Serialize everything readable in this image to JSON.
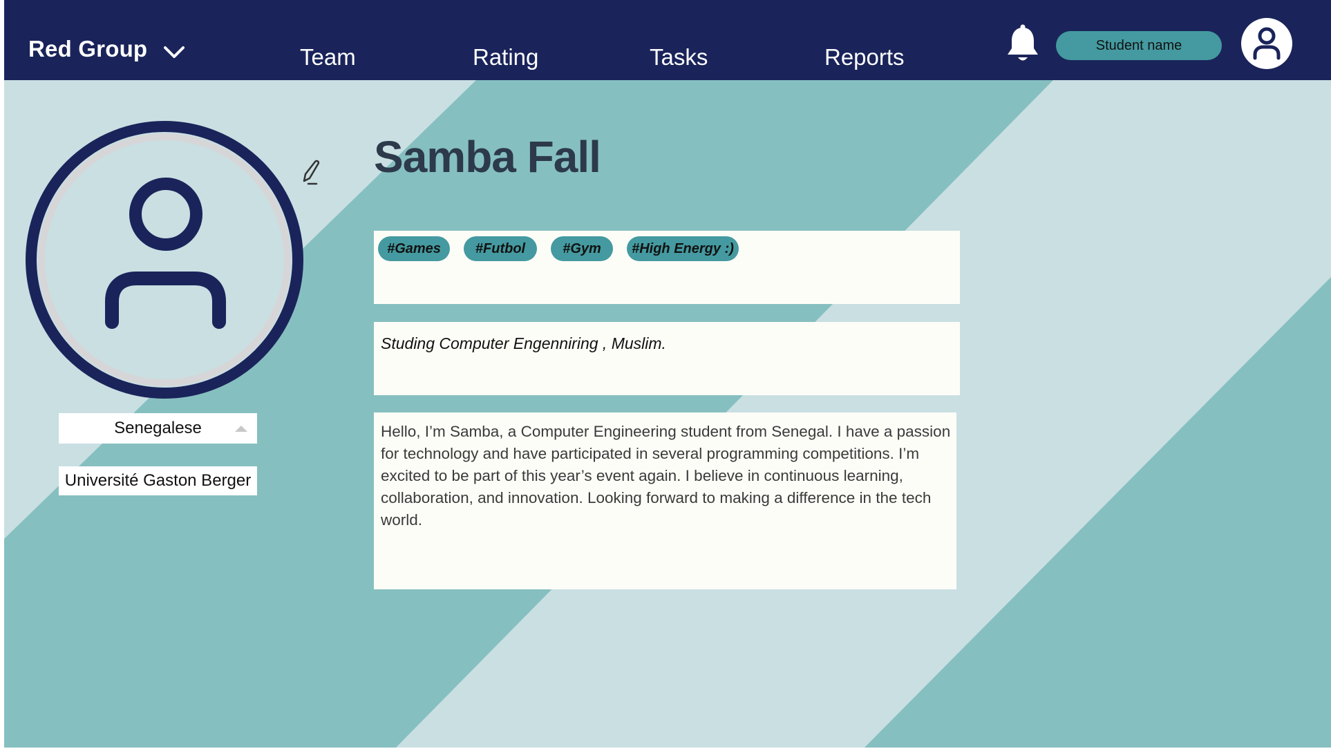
{
  "header": {
    "group_name": "Red Group",
    "nav": [
      "Team",
      "Rating",
      "Tasks",
      "Reports"
    ],
    "student_label": "Student name",
    "icons": [
      "chevron-down-icon",
      "bell-icon",
      "user-avatar-icon"
    ]
  },
  "profile": {
    "name": "Samba Fall",
    "nationality": "Senegalese",
    "university": "Université Gaston Berger",
    "tags": [
      "#Games",
      "#Futbol",
      "#Gym",
      "#High Energy :)"
    ],
    "subtitle": "Studing Computer Engenniring , Muslim.",
    "bio": "Hello, I’m Samba, a Computer Engineering student from Senegal. I have a passion for technology and have participated in several programming competitions. I’m excited to be part of this year’s event again. I believe in continuous learning, collaboration, and innovation. Looking forward to making a difference in the tech world."
  },
  "colors": {
    "navbar": "#1a245a",
    "accent": "#449aa0",
    "background_light": "#c9dfe2",
    "background_mid": "#86bfc0",
    "card": "#fdfdf8",
    "name_text": "#2c3a4b"
  }
}
